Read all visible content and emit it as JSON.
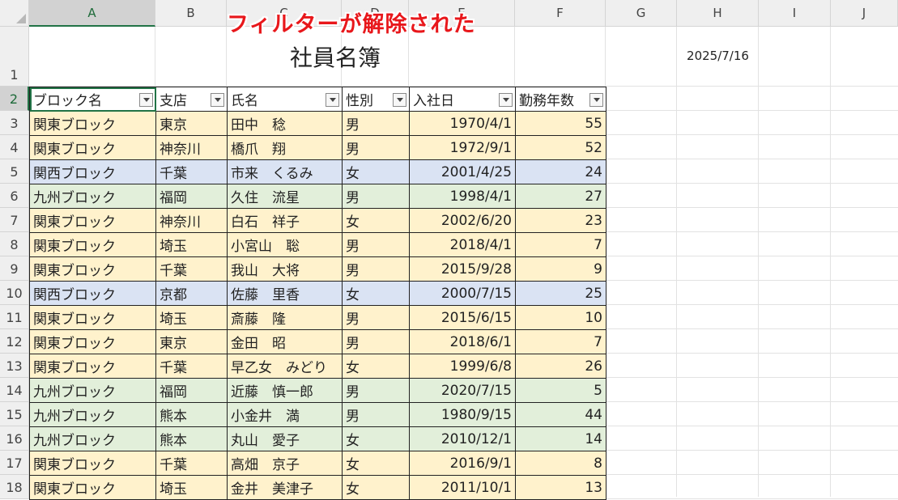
{
  "overlay": {
    "caption": "フィルターが解除された"
  },
  "columns": [
    "A",
    "B",
    "C",
    "D",
    "E",
    "F",
    "G",
    "H",
    "I",
    "J"
  ],
  "rows": [
    "1",
    "2",
    "3",
    "4",
    "5",
    "6",
    "7",
    "8",
    "9",
    "10",
    "11",
    "12",
    "13",
    "14",
    "15",
    "16",
    "17",
    "18"
  ],
  "sheet_title": "社員名簿",
  "date_value": "2025/7/16",
  "table_headers": [
    "ブロック名",
    "支店",
    "氏名",
    "性別",
    "入社日",
    "勤務年数"
  ],
  "records": [
    {
      "block": "関東ブロック",
      "branch": "東京",
      "name": "田中　稔",
      "gender": "男",
      "hired": "1970/4/1",
      "years": "55",
      "fill": "#fff2cc"
    },
    {
      "block": "関東ブロック",
      "branch": "神奈川",
      "name": "橋爪　翔",
      "gender": "男",
      "hired": "1972/9/1",
      "years": "52",
      "fill": "#fff2cc"
    },
    {
      "block": "関西ブロック",
      "branch": "千葉",
      "name": "市来　くるみ",
      "gender": "女",
      "hired": "2001/4/25",
      "years": "24",
      "fill": "#dae3f3"
    },
    {
      "block": "九州ブロック",
      "branch": "福岡",
      "name": "久住　流星",
      "gender": "男",
      "hired": "1998/4/1",
      "years": "27",
      "fill": "#e2efda"
    },
    {
      "block": "関東ブロック",
      "branch": "神奈川",
      "name": "白石　祥子",
      "gender": "女",
      "hired": "2002/6/20",
      "years": "23",
      "fill": "#fff2cc"
    },
    {
      "block": "関東ブロック",
      "branch": "埼玉",
      "name": "小宮山　聡",
      "gender": "男",
      "hired": "2018/4/1",
      "years": "7",
      "fill": "#fff2cc"
    },
    {
      "block": "関東ブロック",
      "branch": "千葉",
      "name": "我山　大将",
      "gender": "男",
      "hired": "2015/9/28",
      "years": "9",
      "fill": "#fff2cc"
    },
    {
      "block": "関西ブロック",
      "branch": "京都",
      "name": "佐藤　里香",
      "gender": "女",
      "hired": "2000/7/15",
      "years": "25",
      "fill": "#dae3f3"
    },
    {
      "block": "関東ブロック",
      "branch": "埼玉",
      "name": "斎藤　隆",
      "gender": "男",
      "hired": "2015/6/15",
      "years": "10",
      "fill": "#fff2cc"
    },
    {
      "block": "関東ブロック",
      "branch": "東京",
      "name": "金田　昭",
      "gender": "男",
      "hired": "2018/6/1",
      "years": "7",
      "fill": "#fff2cc"
    },
    {
      "block": "関東ブロック",
      "branch": "千葉",
      "name": "早乙女　みどり",
      "gender": "女",
      "hired": "1999/6/8",
      "years": "26",
      "fill": "#fff2cc"
    },
    {
      "block": "九州ブロック",
      "branch": "福岡",
      "name": "近藤　慎一郎",
      "gender": "男",
      "hired": "2020/7/15",
      "years": "5",
      "fill": "#e2efda"
    },
    {
      "block": "九州ブロック",
      "branch": "熊本",
      "name": "小金井　満",
      "gender": "男",
      "hired": "1980/9/15",
      "years": "44",
      "fill": "#e2efda"
    },
    {
      "block": "九州ブロック",
      "branch": "熊本",
      "name": "丸山　愛子",
      "gender": "女",
      "hired": "2010/12/1",
      "years": "14",
      "fill": "#e2efda"
    },
    {
      "block": "関東ブロック",
      "branch": "千葉",
      "name": "高畑　京子",
      "gender": "女",
      "hired": "2016/9/1",
      "years": "8",
      "fill": "#fff2cc"
    },
    {
      "block": "関東ブロック",
      "branch": "埼玉",
      "name": "金井　美津子",
      "gender": "女",
      "hired": "2011/10/1",
      "years": "13",
      "fill": "#fff2cc"
    }
  ]
}
